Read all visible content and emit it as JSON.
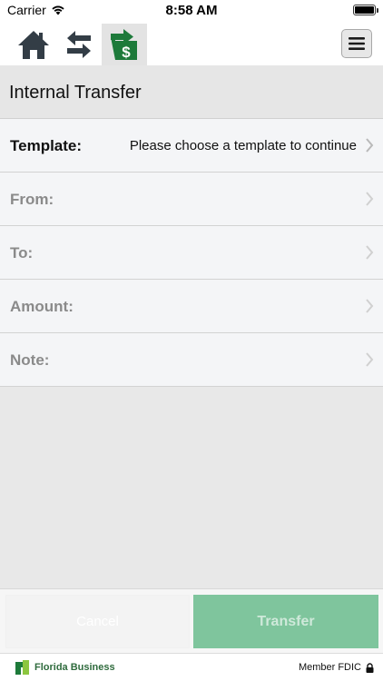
{
  "status_bar": {
    "carrier": "Carrier",
    "time": "8:58 AM"
  },
  "navbar": {
    "icons": [
      "home-icon",
      "transfer-arrows-icon",
      "move-money-icon"
    ],
    "menu_icon": "hamburger-menu-icon"
  },
  "page": {
    "title": "Internal Transfer"
  },
  "form": {
    "rows": [
      {
        "label": "Template:",
        "value": "Please choose a template to continue"
      },
      {
        "label": "From:",
        "value": ""
      },
      {
        "label": "To:",
        "value": ""
      },
      {
        "label": "Amount:",
        "value": ""
      },
      {
        "label": "Note:",
        "value": ""
      }
    ]
  },
  "buttons": {
    "cancel_label": "Cancel",
    "transfer_label": "Transfer"
  },
  "footer": {
    "brand_name": "Florida Business",
    "member_text": "Member FDIC"
  },
  "colors": {
    "brand_green": "#1d7a3a",
    "transfer_button": "#7fc59d",
    "nav_icon_dark": "#333d46"
  }
}
